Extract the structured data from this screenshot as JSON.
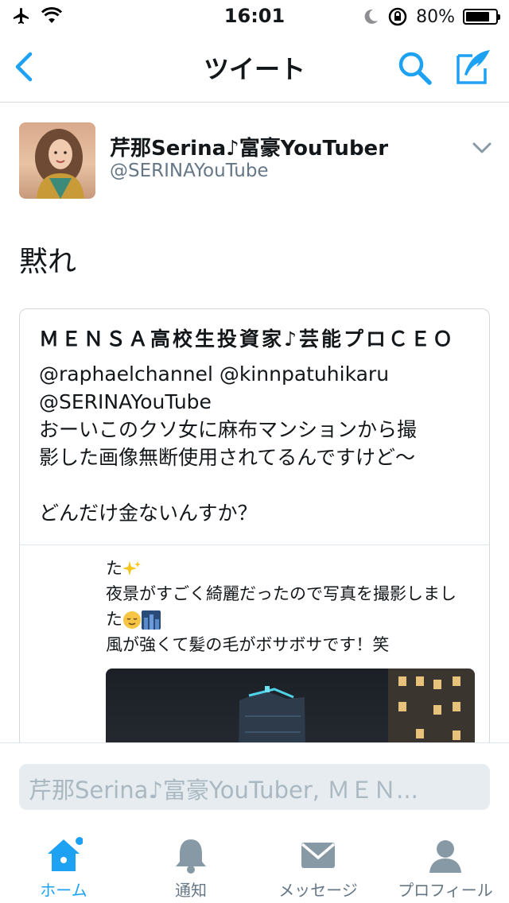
{
  "status_bar": {
    "time": "16:01",
    "battery": "80%",
    "battery_level": 0.8
  },
  "nav": {
    "title": "ツイート"
  },
  "tweet": {
    "name": "芹那Serina♪富豪YouTuber",
    "handle": "@SERINAYouTube",
    "text": "黙れ"
  },
  "quoted": {
    "author": "ＭＥＮＳＡ高校生投資家♪芸能プロＣＥＯ",
    "lines": [
      "@raphaelchannel @kinnpatuhikaru",
      "@SERINAYouTube",
      "おーいこのクソ女に麻布マンションから撮",
      "影した画像無断使用されてるんですけど～",
      "どんだけ金ないんすか？"
    ],
    "embedded": {
      "line1": "た",
      "line2": "夜景がすごく綺麗だったので写真を撮影しまし",
      "line3": "た",
      "line4": "風が強くて髪の毛がボサボサです！笑"
    }
  },
  "reply": {
    "placeholder": "芹那Serina♪富豪YouTuber, ＭＥＮ..."
  },
  "tabs": [
    {
      "label": "ホーム",
      "icon": "home-icon",
      "active": true
    },
    {
      "label": "通知",
      "icon": "bell-icon",
      "active": false
    },
    {
      "label": "メッセージ",
      "icon": "envelope-icon",
      "active": false
    },
    {
      "label": "プロフィール",
      "icon": "person-icon",
      "active": false
    }
  ],
  "colors": {
    "accent": "#1da1f2",
    "secondary_text": "#657786",
    "border": "#d6d8da",
    "input_bg": "#e6ecf0"
  }
}
